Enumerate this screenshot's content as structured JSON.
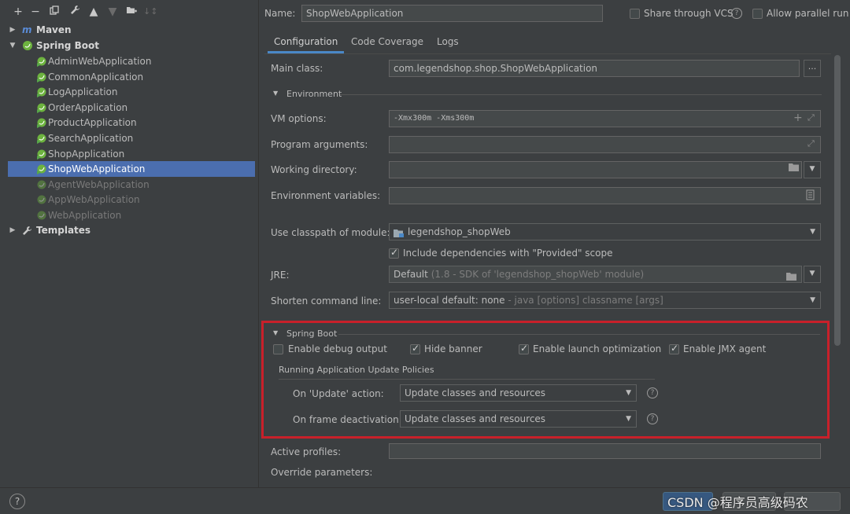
{
  "toolbar": {
    "add_icon": "plus-icon",
    "remove_icon": "minus-icon",
    "copy_icon": "copy-icon",
    "edit_icon": "wrench-icon",
    "up_icon": "arrow-up-icon",
    "down_icon": "arrow-down-icon",
    "folder_icon": "folder-plus-icon",
    "sort_icon": "sort-icon"
  },
  "tree": {
    "maven": "Maven",
    "spring_boot": "Spring Boot",
    "items": [
      "AdminWebApplication",
      "CommonApplication",
      "LogApplication",
      "OrderApplication",
      "ProductApplication",
      "SearchApplication",
      "ShopApplication",
      "ShopWebApplication",
      "AgentWebApplication",
      "AppWebApplication",
      "WebApplication"
    ],
    "selected": "ShopWebApplication",
    "templates": "Templates"
  },
  "header": {
    "name_label": "Name:",
    "name_value": "ShopWebApplication",
    "share_vcs": "Share through VCS",
    "allow_parallel": "Allow parallel run"
  },
  "tabs": [
    "Configuration",
    "Code Coverage",
    "Logs"
  ],
  "config": {
    "main_class_label": "Main class:",
    "main_class_value": "com.legendshop.shop.ShopWebApplication",
    "browse_label": "...",
    "environment_title": "Environment",
    "vm_options_label": "VM options:",
    "vm_options_value": "-Xmx300m -Xms300m",
    "program_args_label": "Program arguments:",
    "working_dir_label": "Working directory:",
    "env_vars_label": "Environment variables:",
    "classpath_label": "Use classpath of module:",
    "classpath_value": "legendshop_shopWeb",
    "include_deps_label": "Include dependencies with \"Provided\" scope",
    "jre_label": "JRE:",
    "jre_value": "Default",
    "jre_hint": "(1.8 - SDK of 'legendshop_shopWeb' module)",
    "shorten_label": "Shorten command line:",
    "shorten_value": "user-local default: none",
    "shorten_hint": "- java [options] classname [args]"
  },
  "spring_boot": {
    "title": "Spring Boot",
    "debug_output": "Enable debug output",
    "hide_banner": "Hide banner",
    "launch_opt": "Enable launch optimization",
    "jmx_agent": "Enable JMX agent",
    "policies_title": "Running Application Update Policies",
    "update_action_label": "On 'Update' action:",
    "update_action_value": "Update classes and resources",
    "frame_deactivation_label": "On frame deactivation:",
    "frame_deactivation_value": "Update classes and resources",
    "highlight_color": "#c8202a"
  },
  "bottom": {
    "active_profiles_label": "Active profiles:",
    "override_params_label": "Override parameters:",
    "watermark": "CSDN @程序员高级码农"
  }
}
